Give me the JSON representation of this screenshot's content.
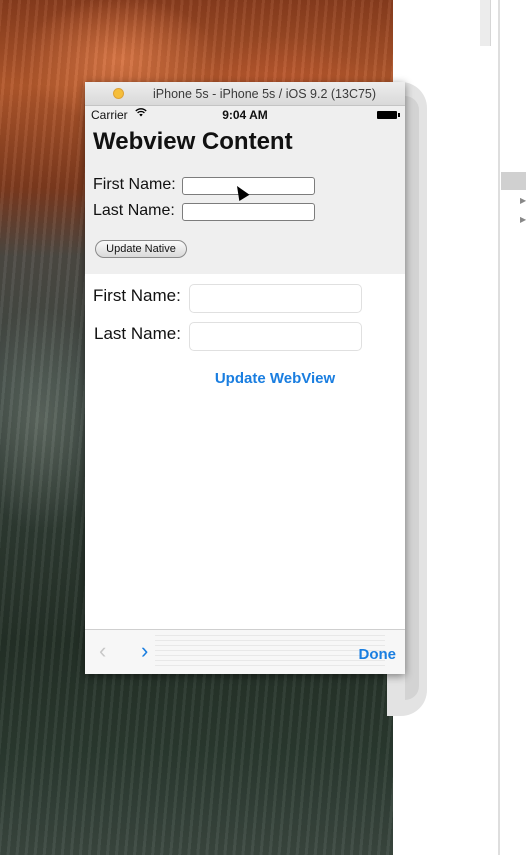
{
  "simulator": {
    "title": "iPhone 5s - iPhone 5s / iOS 9.2 (13C75)"
  },
  "statusbar": {
    "carrier": "Carrier",
    "time": "9:04 AM"
  },
  "webview": {
    "heading": "Webview Content",
    "first_name_label": "First Name:",
    "last_name_label": "Last Name:",
    "first_name_value": "",
    "last_name_value": "",
    "update_native_label": "Update Native"
  },
  "native": {
    "first_name_label": "First Name:",
    "last_name_label": "Last Name:",
    "first_name_value": "",
    "last_name_value": "",
    "update_webview_label": "Update WebView"
  },
  "toolbar": {
    "back_icon": "‹",
    "forward_icon": "›",
    "done_label": "Done"
  },
  "colors": {
    "accent": "#1a7ee0",
    "webview_bg": "#efefef"
  }
}
